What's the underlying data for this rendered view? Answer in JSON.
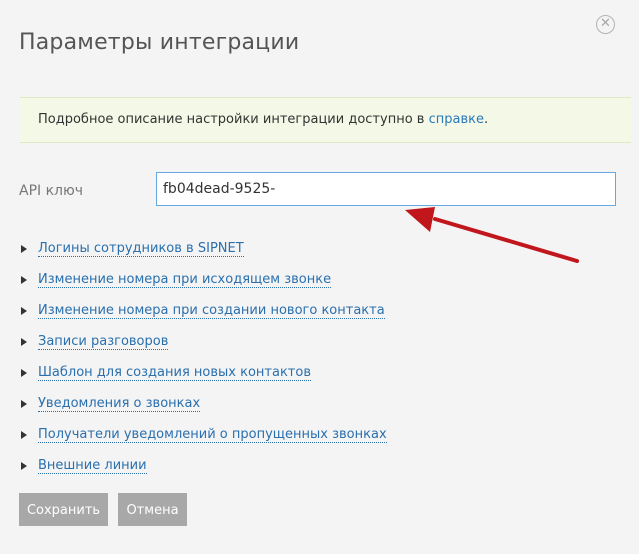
{
  "dialog": {
    "title": "Параметры интеграции",
    "close_icon": "close-circle-icon"
  },
  "info": {
    "text": "Подробное описание настройки интеграции доступно в ",
    "link_label": "справке",
    "suffix": "."
  },
  "api_key": {
    "label": "API ключ",
    "value": "fb04dead-9525-"
  },
  "sections": [
    {
      "label": "Логины сотрудников в SIPNET"
    },
    {
      "label": "Изменение номера при исходящем звонке"
    },
    {
      "label": "Изменение номера при создании нового контакта"
    },
    {
      "label": "Записи разговоров"
    },
    {
      "label": "Шаблон для создания новых контактов"
    },
    {
      "label": "Уведомления о звонках"
    },
    {
      "label": "Получатели уведомлений о пропущенных звонках"
    },
    {
      "label": "Внешние линии"
    }
  ],
  "buttons": {
    "save_label": "Сохранить",
    "cancel_label": "Отмена"
  },
  "colors": {
    "annotation_arrow": "#c0161c",
    "link": "#2a6fae",
    "button": "#a8a8a8"
  }
}
